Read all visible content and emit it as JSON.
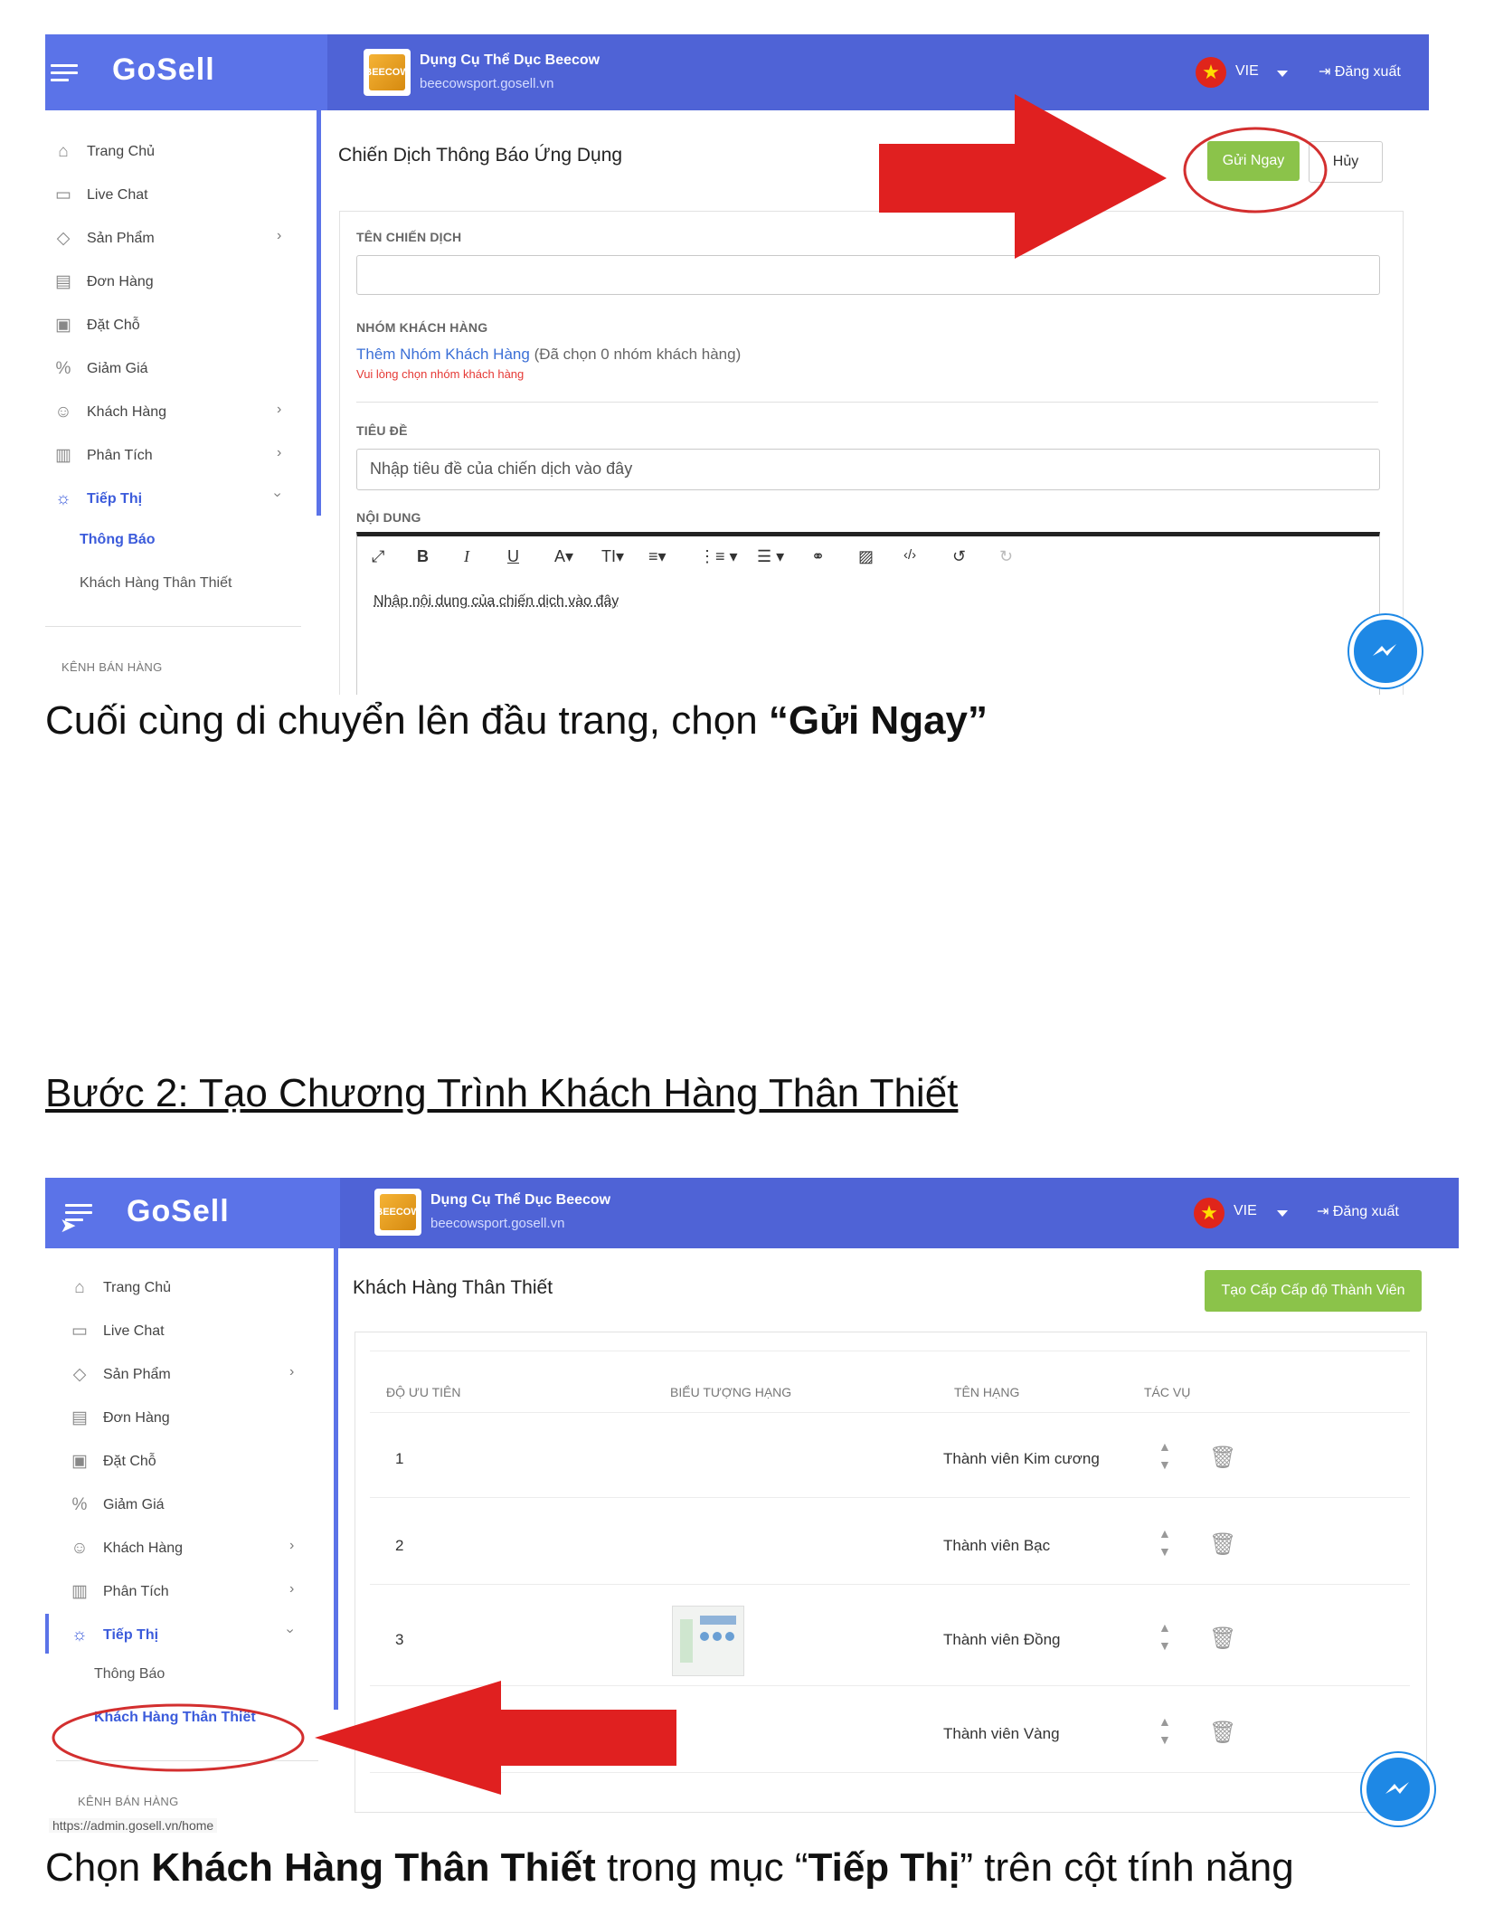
{
  "brand": "GoSell",
  "shop": {
    "name": "Dụng Cụ Thể Dục Beecow",
    "url": "beecowsport.gosell.vn",
    "logo_text": "BEECOW"
  },
  "header": {
    "lang": "VIE",
    "logout": "Đăng xuất"
  },
  "sidebar": {
    "items": [
      {
        "label": "Trang Chủ",
        "icon": "home-icon"
      },
      {
        "label": "Live Chat",
        "icon": "chat-icon"
      },
      {
        "label": "Sản Phẩm",
        "icon": "tag-icon"
      },
      {
        "label": "Đơn Hàng",
        "icon": "document-icon"
      },
      {
        "label": "Đặt Chỗ",
        "icon": "calendar-icon"
      },
      {
        "label": "Giảm Giá",
        "icon": "percent-icon"
      },
      {
        "label": "Khách Hàng",
        "icon": "users-icon"
      },
      {
        "label": "Phân Tích",
        "icon": "bar-chart-icon"
      },
      {
        "label": "Tiếp Thị",
        "icon": "bulb-icon"
      }
    ],
    "sub_items": [
      "Thông Báo",
      "Khách Hàng Thân Thiết"
    ],
    "section_label": "KÊNH BÁN HÀNG"
  },
  "shot1": {
    "title": "Chiến Dịch Thông Báo Ứng Dụng",
    "send_now": "Gửi Ngay",
    "cancel": "Hủy",
    "campaign_name_label": "TÊN CHIẾN DỊCH",
    "campaign_name_value": "",
    "customer_group_label": "NHÓM KHÁCH HÀNG",
    "add_group_link": "Thêm Nhóm Khách Hàng",
    "group_selected_note": "(Đã chọn 0 nhóm khách hàng)",
    "group_error": "Vui lòng chọn nhóm khách hàng",
    "subject_label": "TIÊU ĐỀ",
    "subject_placeholder": "Nhập tiêu đề của chiến dịch vào đây",
    "content_label": "NỘI DUNG",
    "content_placeholder": "Nhập nội dung của chiến dịch vào đây"
  },
  "caption1": {
    "text": "Cuối cùng di chuyển lên đầu trang, chọn ",
    "bold": "“Gửi Ngay”"
  },
  "step2_heading": "Bước 2: Tạo Chương Trình Khách Hàng Thân Thiết ",
  "shot2": {
    "title": "Khách Hàng Thân Thiết",
    "create_button": "Tạo Cấp Cấp độ Thành Viên",
    "columns": [
      "ĐỘ ƯU TIÊN",
      "BIỂU TƯỢNG HẠNG",
      "TÊN HẠNG",
      "TÁC VỤ"
    ],
    "rows": [
      {
        "priority": "1",
        "name": "Thành viên Kim cương",
        "has_icon": false
      },
      {
        "priority": "2",
        "name": "Thành viên Bạc",
        "has_icon": false
      },
      {
        "priority": "3",
        "name": "Thành viên Đồng",
        "has_icon": true
      },
      {
        "priority": "",
        "name": "Thành viên Vàng",
        "has_icon": false
      }
    ],
    "status_url": "https://admin.gosell.vn/home"
  },
  "caption2": {
    "p1": "Chọn ",
    "b1": "Khách Hàng Thân Thiết",
    "p2": " trong mục “",
    "b2": "Tiếp Thị",
    "p3": "” trên cột tính năng"
  },
  "colors": {
    "header": "#4f63d6",
    "accent_green": "#8bc34a",
    "arrow_red": "#e02020",
    "link_blue": "#3b5bdb"
  }
}
